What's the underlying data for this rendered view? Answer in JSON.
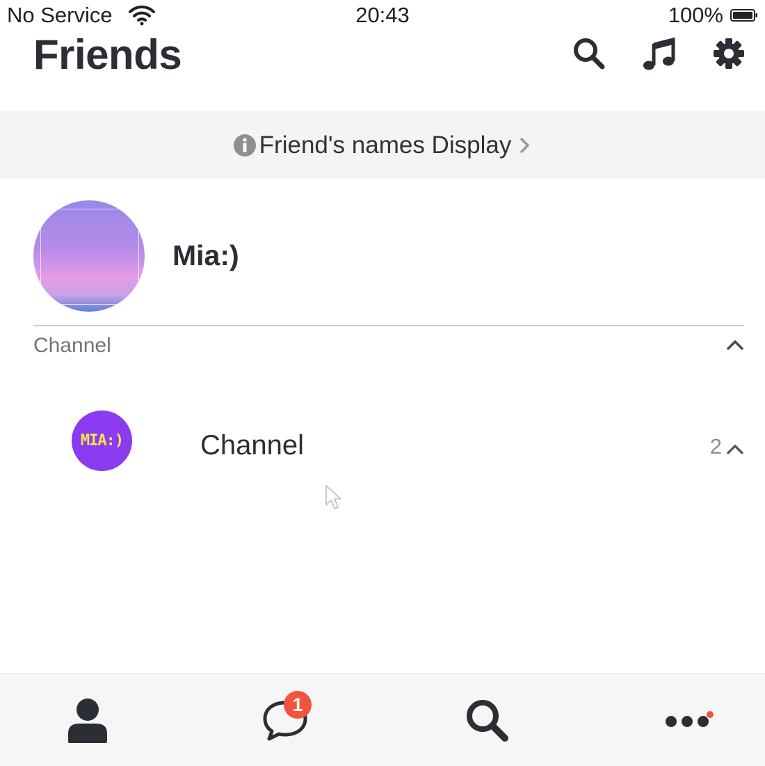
{
  "status_bar": {
    "carrier": "No Service",
    "time": "20:43",
    "battery": "100%"
  },
  "header": {
    "title": "Friends"
  },
  "banner": {
    "text": "Friend's names Display"
  },
  "profile": {
    "name": "Mia:)"
  },
  "section": {
    "label": "Channel"
  },
  "channel": {
    "avatar_text": "MIA:)",
    "name": "Channel",
    "count": "2"
  },
  "tabbar": {
    "chats_badge": "1"
  },
  "colors": {
    "badge": "#f0543e",
    "text_dark": "#2b2e34",
    "channel_avatar": "#8b3bf0",
    "channel_avatar_text": "#f4e64a"
  },
  "icons": [
    "wifi-icon",
    "battery-icon",
    "search-icon",
    "music-note-icon",
    "gear-icon",
    "info-icon",
    "chevron-right-icon",
    "chevron-up-icon",
    "person-icon",
    "chat-bubble-icon",
    "more-dots-icon"
  ]
}
